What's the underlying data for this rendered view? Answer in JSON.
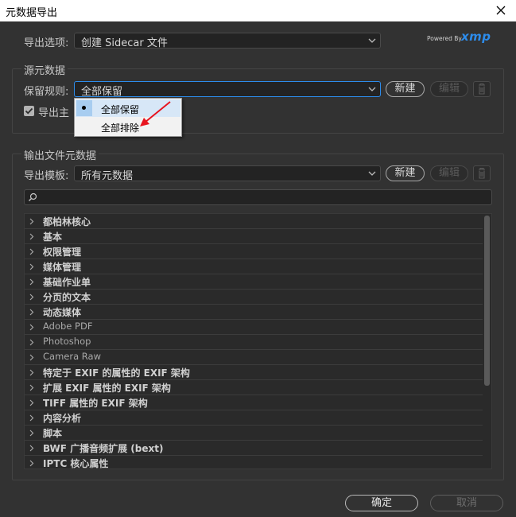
{
  "window": {
    "title": "元数据导出"
  },
  "export_option": {
    "label": "导出选项:",
    "value": "创建 Sidecar 文件"
  },
  "xmp_logo": {
    "powered": "Powered By",
    "brand": "xmp"
  },
  "source_metadata": {
    "group_title": "源元数据",
    "rule_label": "保留规则:",
    "rule_value": "全部保留",
    "new_label": "新建",
    "edit_label": "编辑",
    "export_main_label": "导出主"
  },
  "rule_menu": {
    "options": [
      {
        "label": "全部保留",
        "selected": true
      },
      {
        "label": "全部排除",
        "selected": false
      }
    ]
  },
  "output_metadata": {
    "group_title": "输出文件元数据",
    "template_label": "导出模板:",
    "template_value": "所有元数据",
    "new_label": "新建",
    "edit_label": "编辑",
    "search_placeholder": ""
  },
  "tree": {
    "items": [
      "都柏林核心",
      "基本",
      "权限管理",
      "媒体管理",
      "基础作业单",
      "分页的文本",
      "动态媒体",
      "Adobe PDF",
      "Photoshop",
      "Camera Raw",
      "特定于 EXIF 的属性的 EXIF 架构",
      "扩展 EXIF 属性的 EXIF 架构",
      "TIFF 属性的 EXIF 架构",
      "内容分析",
      "脚本",
      "BWF 广播音频扩展 (bext)",
      "IPTC 核心属性"
    ]
  },
  "footer": {
    "ok_label": "确定",
    "cancel_label": "取消"
  },
  "colors": {
    "accent_arrow": "#e8141e",
    "focus_border": "#2d8ceb",
    "popup_selected": "#a8cdf0"
  }
}
